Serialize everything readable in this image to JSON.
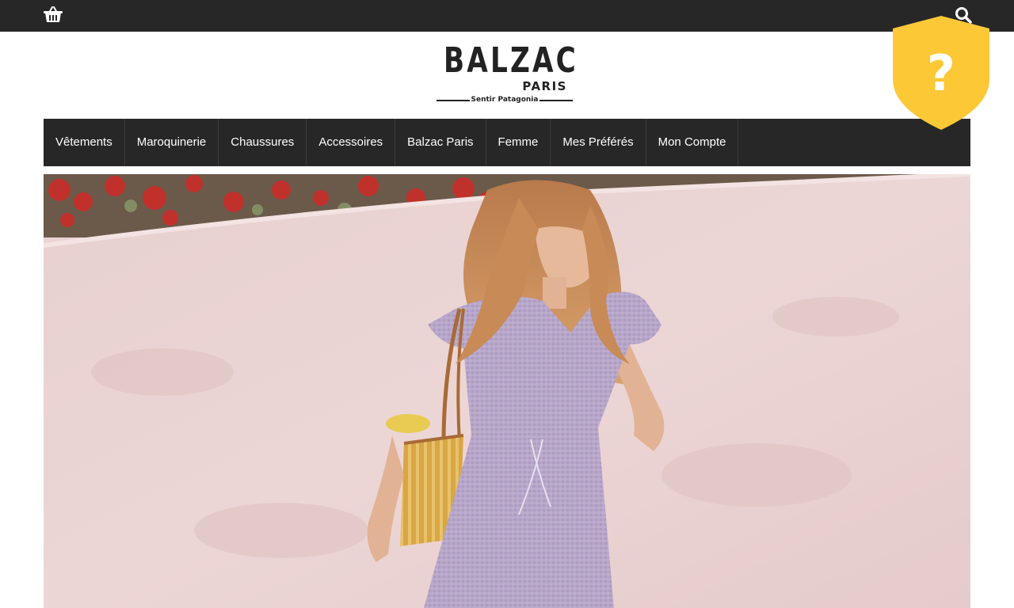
{
  "topbar": {
    "cart_icon": "shopping-basket-icon",
    "search_icon": "search-icon"
  },
  "logo": {
    "brand": "BALZAC",
    "city": "PARIS",
    "tagline": "Sentir Patagonia"
  },
  "nav": {
    "items": [
      {
        "label": "Vêtements"
      },
      {
        "label": "Maroquinerie"
      },
      {
        "label": "Chaussures"
      },
      {
        "label": "Accessoires"
      },
      {
        "label": "Balzac Paris"
      },
      {
        "label": "Femme"
      },
      {
        "label": "Mes Préférés"
      },
      {
        "label": "Mon Compte"
      }
    ]
  },
  "badge": {
    "icon": "question-shield-icon",
    "symbol": "?"
  },
  "hero": {
    "image": "woman-in-lilac-gingham-outfit-with-straw-bag"
  },
  "colors": {
    "topbar": "#272727",
    "nav": "#272727",
    "badge": "#FDC836",
    "wall": "#EAD3D3"
  }
}
